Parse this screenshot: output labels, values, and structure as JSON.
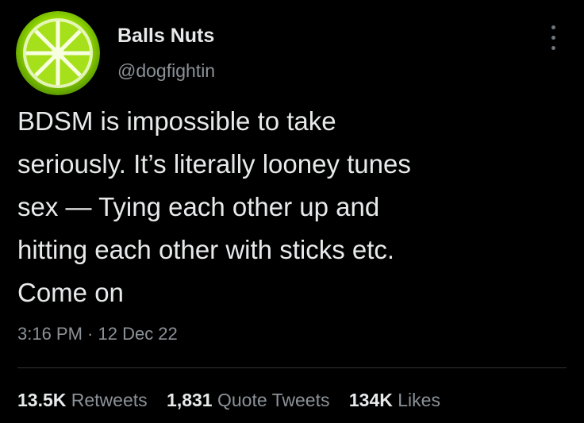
{
  "author": {
    "display_name": "Balls Nuts",
    "handle": "@dogfightin",
    "avatar_icon": "limewire-logo-icon"
  },
  "tweet": {
    "lines": [
      "BDSM is impossible to take",
      "seriously. It’s literally looney tunes",
      "sex — Tying each other up and",
      "hitting each other with sticks etc.",
      "Come on"
    ],
    "timestamp": "3:16 PM · 12 Dec 22"
  },
  "stats": {
    "retweets": {
      "count": "13.5K",
      "label": "Retweets"
    },
    "quotes": {
      "count": "1,831",
      "label": "Quote Tweets"
    },
    "likes": {
      "count": "134K",
      "label": "Likes"
    }
  },
  "icons": {
    "more": "more-options-icon"
  },
  "colors": {
    "background": "#000000",
    "primary_text": "#e7e9ea",
    "secondary_text": "#8b9298",
    "avatar_green": "#8fd400"
  }
}
